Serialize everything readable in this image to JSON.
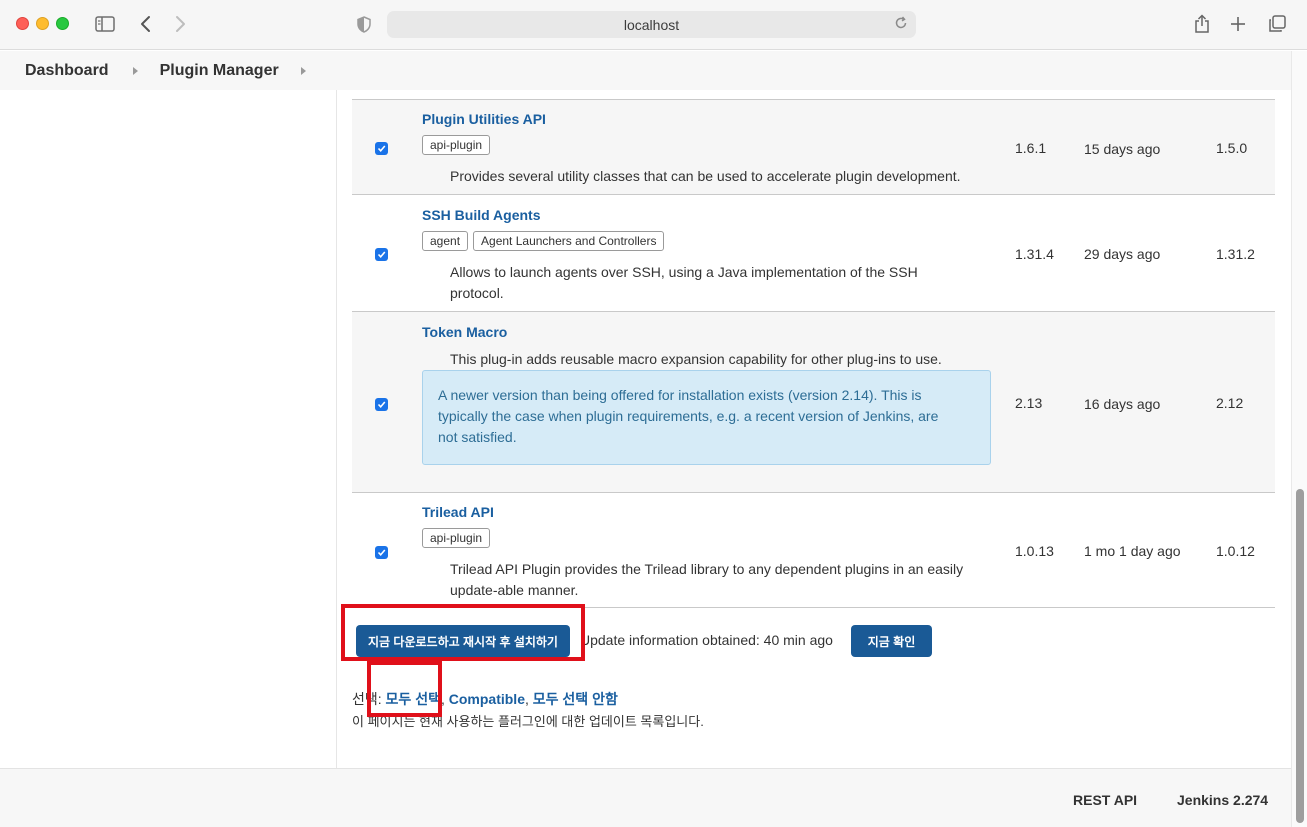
{
  "browser": {
    "url": "localhost",
    "icons": [
      "sidebar-icon",
      "back-icon",
      "forward-icon",
      "shield-icon",
      "reload-icon",
      "share-icon",
      "new-tab-icon",
      "tabs-overview-icon"
    ]
  },
  "breadcrumb": {
    "items": [
      "Dashboard",
      "Plugin Manager"
    ]
  },
  "plugins": [
    {
      "name": "Plugin Utilities API",
      "tags": [
        "api-plugin"
      ],
      "description": "Provides several utility classes that can be used to accelerate plugin development.",
      "version": "1.6.1",
      "released": "15 days ago",
      "installed": "1.5.0",
      "checked": true
    },
    {
      "name": "SSH Build Agents",
      "tags": [
        "agent",
        "Agent Launchers and Controllers"
      ],
      "description_lines": [
        "Allows to launch agents over SSH, using a Java implementation of the SSH",
        "protocol."
      ],
      "version": "1.31.4",
      "released": "29 days ago",
      "installed": "1.31.2",
      "checked": true
    },
    {
      "name": "Token Macro",
      "tags": [],
      "description": "This plug-in adds reusable macro expansion capability for other plug-ins to use.",
      "notice_lines": [
        "A newer version than being offered for installation exists (version 2.14). This is",
        "typically the case when plugin requirements, e.g. a recent version of Jenkins, are",
        "not satisfied."
      ],
      "version": "2.13",
      "released": "16 days ago",
      "installed": "2.12",
      "checked": true
    },
    {
      "name": "Trilead API",
      "tags": [
        "api-plugin"
      ],
      "description_lines": [
        "Trilead API Plugin provides the Trilead library to any dependent plugins in an easily",
        "update-able manner."
      ],
      "version": "1.0.13",
      "released": "1 mo 1 day ago",
      "installed": "1.0.12",
      "checked": true
    }
  ],
  "actions": {
    "install_label": "지금 다운로드하고 재시작 후 설치하기",
    "update_info": "Update information obtained: 40 min ago",
    "check_now_label": "지금 확인"
  },
  "selection": {
    "prefix": "선택: ",
    "all": "모두 선택",
    "comma": ", ",
    "compatible": "Compatible",
    "none": "모두 선택 안함"
  },
  "info_text": "이 페이지는 현재 사용하는 플러그인에 대한 업데이트 목록입니다.",
  "footer": {
    "rest_api": "REST API",
    "jenkins_version": "Jenkins 2.274"
  },
  "colors": {
    "accent": "#1a5a96",
    "link": "#1a5fa0",
    "highlight": "#e0101a",
    "checkbox": "#1a73e8"
  }
}
